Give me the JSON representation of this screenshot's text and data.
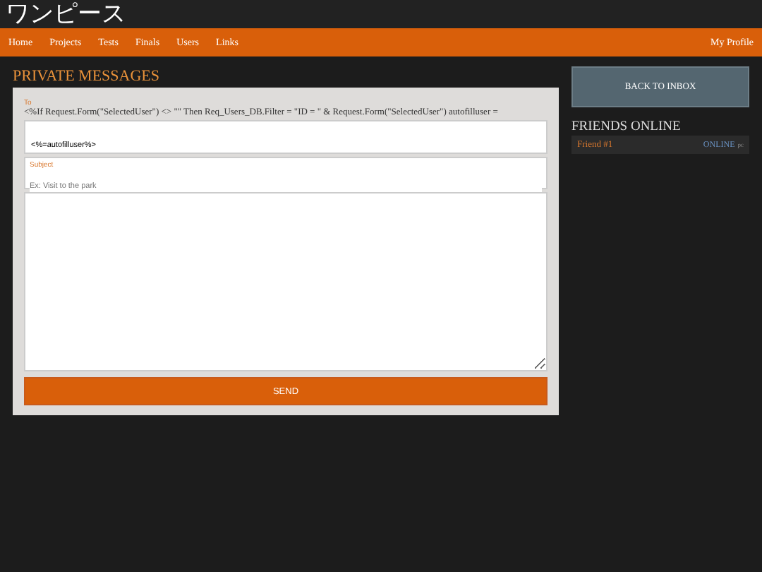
{
  "site_title": "ワンピース",
  "nav": {
    "items": [
      "Home",
      "Projects",
      "Tests",
      "Finals",
      "Users",
      "Links"
    ],
    "profile": "My Profile"
  },
  "heading": "PRIVATE MESSAGES",
  "form": {
    "to_label": "To",
    "to_code": "<%If Request.Form(\"SelectedUser\") <> \"\" Then Req_Users_DB.Filter = \"ID = \" & Request.Form(\"SelectedUser\") autofilluser =",
    "to_value": "<%=autofilluser%>",
    "subject_label": "Subject",
    "subject_placeholder": "Ex: Visit to the park",
    "send": "SEND"
  },
  "back_button": "BACK TO INBOX",
  "friends": {
    "title": "FRIENDS ONLINE",
    "items": [
      {
        "name": "Friend #1",
        "status": "ONLINE",
        "device": "pc"
      }
    ]
  }
}
